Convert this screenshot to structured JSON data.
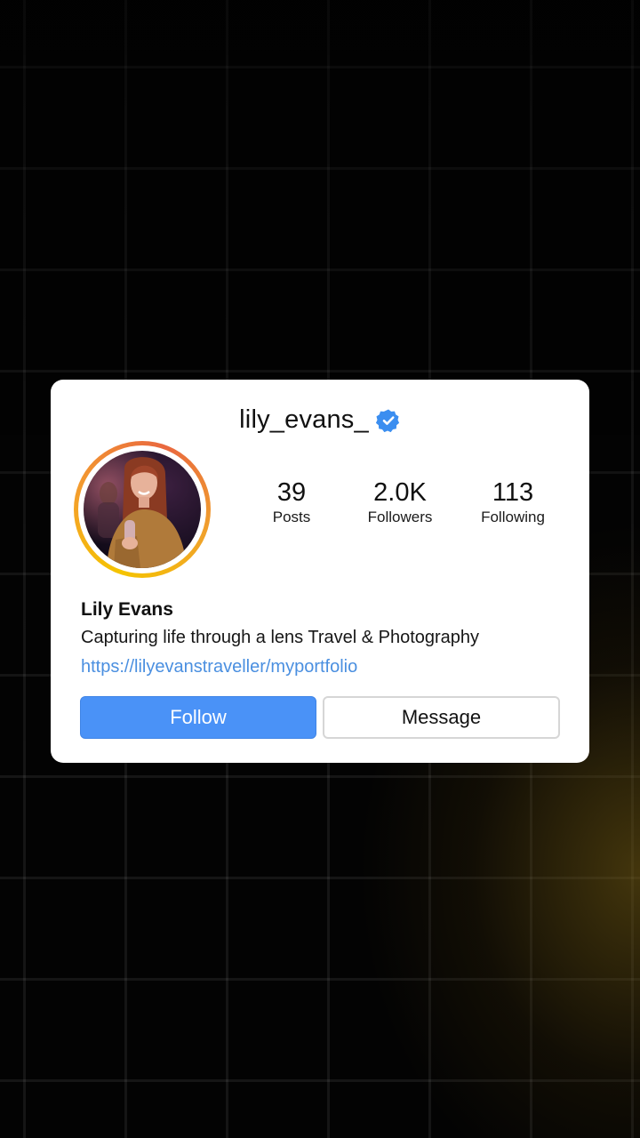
{
  "profile": {
    "username": "lily_evans_",
    "verified_icon": "verified-badge-icon",
    "display_name": "Lily Evans",
    "bio": "Capturing life through a lens Travel & Photography",
    "link": "https://lilyevanstraveller/myportfolio"
  },
  "stats": [
    {
      "value": "39",
      "label": "Posts"
    },
    {
      "value": "2.0K",
      "label": "Followers"
    },
    {
      "value": "113",
      "label": "Following"
    }
  ],
  "actions": {
    "follow_label": "Follow",
    "message_label": "Message"
  },
  "colors": {
    "follow_button": "#4a92f7",
    "link": "#4a8fe0",
    "verified_badge": "#3b8ef0",
    "story_ring": "#f5a623"
  }
}
